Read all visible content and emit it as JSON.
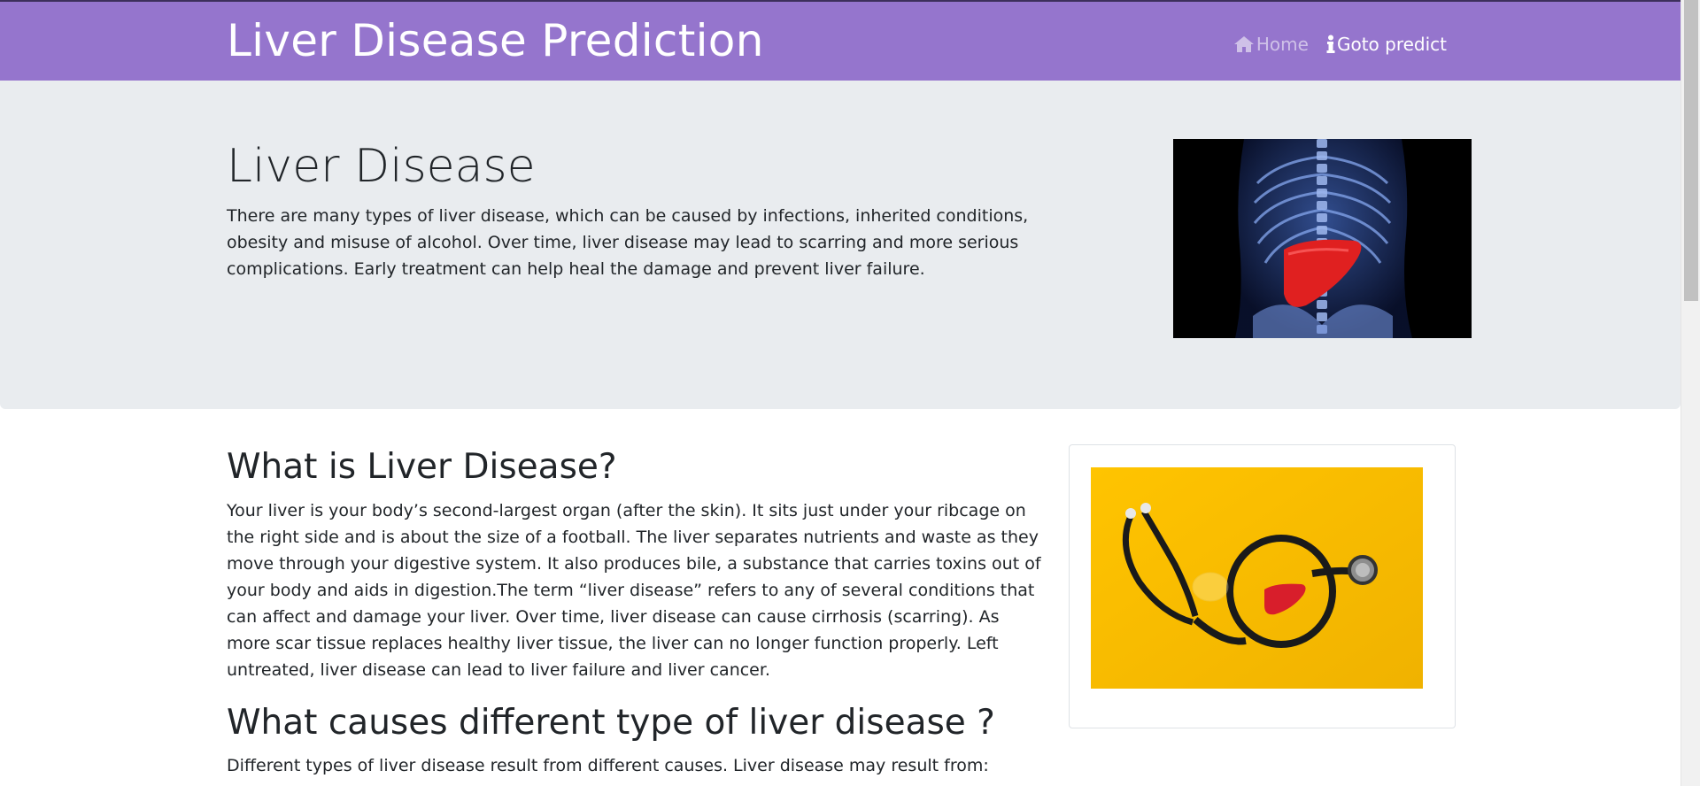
{
  "navbar": {
    "brand": "Liver Disease Prediction",
    "links": [
      {
        "label": "Home",
        "icon": "home-icon"
      },
      {
        "label": "Goto predict",
        "icon": "info-icon"
      }
    ],
    "background": "#9575cd"
  },
  "jumbotron": {
    "title": "Liver Disease",
    "text": "There are many types of liver disease, which can be caused by infections, inherited conditions, obesity and misuse of alcohol. Over time, liver disease may lead to scarring and more serious complications. Early treatment can help heal the damage and prevent liver failure.",
    "image": "xray-torso-liver-image"
  },
  "section1": {
    "title": "What is Liver Disease?",
    "text": "Your liver is your body’s second-largest organ (after the skin). It sits just under your ribcage on the right side and is about the size of a football. The liver separates nutrients and waste as they move through your digestive system. It also produces bile, a substance that carries toxins out of your body and aids in digestion.The term “liver disease” refers to any of several conditions that can affect and damage your liver. Over time, liver disease can cause cirrhosis (scarring). As more scar tissue replaces healthy liver tissue, the liver can no longer function properly. Left untreated, liver disease can lead to liver failure and liver cancer."
  },
  "section2": {
    "title": "What causes different type of liver disease ?",
    "text": "Different types of liver disease result from different causes. Liver disease may result from:"
  },
  "card": {
    "image": "stethoscope-liver-image"
  }
}
